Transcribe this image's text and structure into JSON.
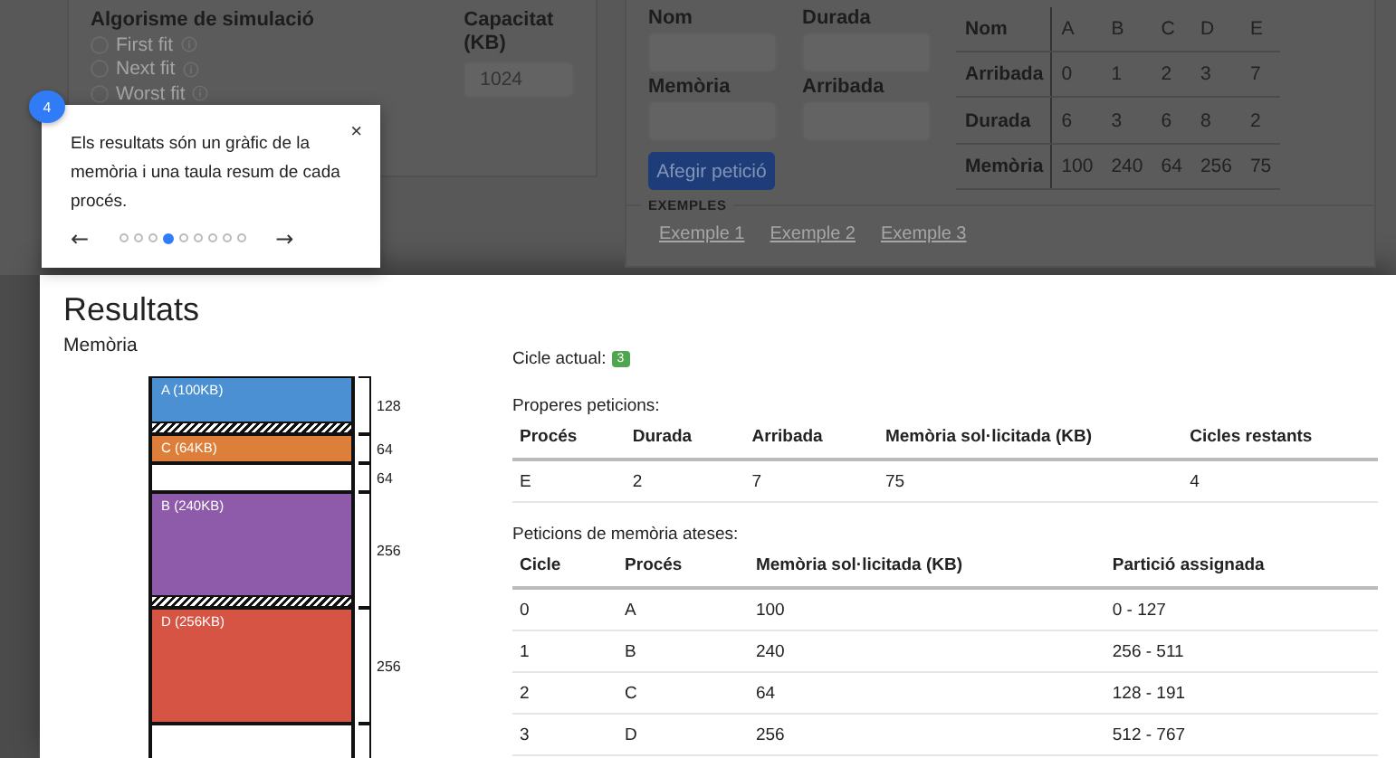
{
  "background": {
    "algorithm": {
      "title": "Algorisme de simulació",
      "options": [
        {
          "label": "First fit",
          "selected": false
        },
        {
          "label": "Next fit",
          "selected": false
        },
        {
          "label": "Worst fit",
          "selected": false
        }
      ]
    },
    "capacity": {
      "label": "Capacitat (KB)",
      "value": "1024"
    },
    "form": {
      "fields": [
        {
          "label": "Nom"
        },
        {
          "label": "Durada"
        },
        {
          "label": "Memòria"
        },
        {
          "label": "Arribada"
        }
      ],
      "button": "Afegir petició"
    },
    "process_table": {
      "rows": [
        [
          "Nom",
          "A",
          "B",
          "C",
          "D",
          "E"
        ],
        [
          "Arribada",
          "0",
          "1",
          "2",
          "3",
          "7"
        ],
        [
          "Durada",
          "6",
          "3",
          "6",
          "8",
          "2"
        ],
        [
          "Memòria",
          "100",
          "240",
          "64",
          "256",
          "75"
        ]
      ]
    },
    "examples": {
      "legend": "EXEMPLES",
      "links": [
        "Exemple 1",
        "Exemple 2",
        "Exemple 3"
      ]
    }
  },
  "tour": {
    "step": "4",
    "text": "Els resultats són un gràfic de la memòria i una taula resum de cada procés.",
    "close": "×",
    "prev": "←",
    "next": "→",
    "dots": [
      {
        "selected": false
      },
      {
        "selected": false
      },
      {
        "selected": false
      },
      {
        "selected": true
      },
      {
        "selected": false
      },
      {
        "selected": false
      },
      {
        "selected": false
      },
      {
        "selected": false
      },
      {
        "selected": false
      }
    ]
  },
  "results": {
    "title": "Resultats",
    "memory": {
      "title": "Memòria",
      "partitions": [
        {
          "kind": "process",
          "label": "A (100KB)",
          "size": "128",
          "color": "#4a90d2",
          "fragmented": true
        },
        {
          "kind": "process",
          "label": "C (64KB)",
          "size": "64",
          "color": "#dd7f3a",
          "fragmented": false
        },
        {
          "kind": "free",
          "size": "64"
        },
        {
          "kind": "process",
          "label": "B (240KB)",
          "size": "256",
          "color": "#8e5bab",
          "fragmented": true
        },
        {
          "kind": "process",
          "label": "D (256KB)",
          "size": "256",
          "color": "#d65443",
          "fragmented": false
        },
        {
          "kind": "free"
        }
      ]
    },
    "cycle": {
      "label": "Cicle actual:",
      "value": "3"
    },
    "upcoming": {
      "title": "Properes peticions:",
      "columns": [
        "Procés",
        "Durada",
        "Arribada",
        "Memòria sol·licitada (KB)",
        "Cicles restants"
      ],
      "rows": [
        [
          "E",
          "2",
          "7",
          "75",
          "4"
        ]
      ]
    },
    "served": {
      "title": "Peticions de memòria ateses:",
      "columns": [
        "Cicle",
        "Procés",
        "Memòria sol·licitada (KB)",
        "Partició assignada"
      ],
      "rows": [
        [
          "0",
          "A",
          "100",
          "0 - 127"
        ],
        [
          "1",
          "B",
          "240",
          "256 - 511"
        ],
        [
          "2",
          "C",
          "64",
          "128 - 191"
        ],
        [
          "3",
          "D",
          "256",
          "512 - 767"
        ]
      ]
    }
  }
}
